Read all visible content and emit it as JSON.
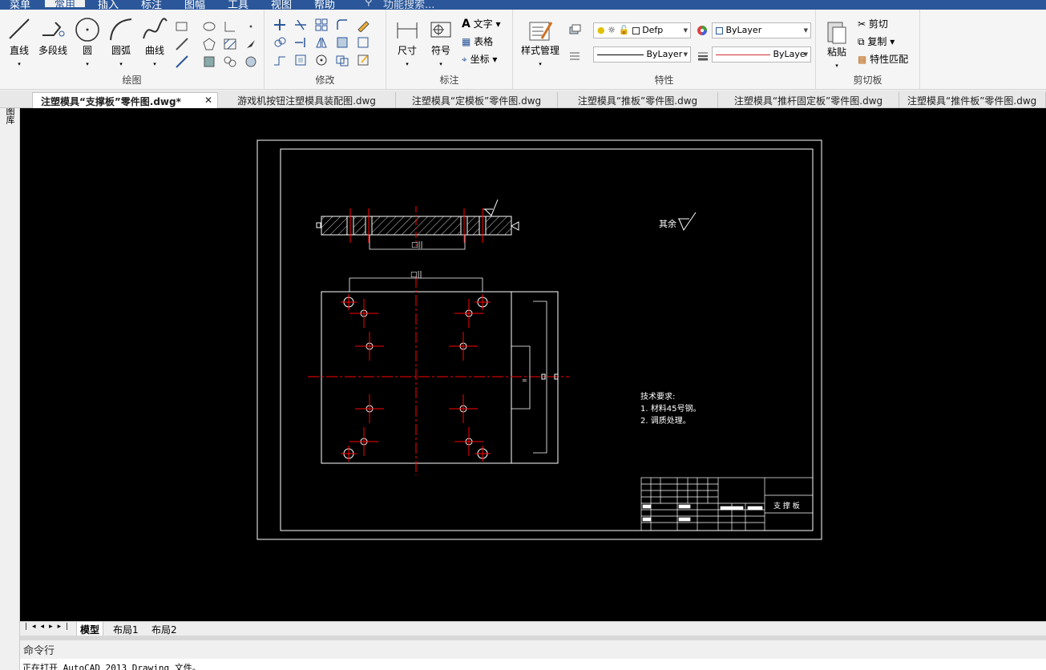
{
  "menu": {
    "items": [
      "菜单",
      "常用",
      "插入",
      "标注",
      "图幅",
      "工具",
      "视图",
      "帮助"
    ],
    "search_placeholder": "功能搜索..."
  },
  "ribbon": {
    "draw": {
      "title": "绘图",
      "line": "直线",
      "polyline": "多段线",
      "circle": "圆",
      "arc": "圆弧",
      "spline": "曲线"
    },
    "modify": {
      "title": "修改"
    },
    "annotate": {
      "title": "标注",
      "dimension": "尺寸",
      "symbol": "符号",
      "text": "文字",
      "table": "表格",
      "coordinate": "坐标"
    },
    "properties": {
      "title": "特性",
      "style_manager": "样式管理",
      "layer_value": "Defp",
      "color_value": "ByLayer",
      "linetype_value": "ByLayer",
      "lineweight_value": "ByLaye"
    },
    "clipboard": {
      "title": "剪切板",
      "paste": "粘贴",
      "cut": "剪切",
      "copy": "复制",
      "match": "特性匹配"
    }
  },
  "doc_tabs": [
    "注塑模具“支撑板”零件图.dwg*",
    "游戏机按钮注塑模具装配图.dwg",
    "注塑模具“定模板”零件图.dwg",
    "注塑模具“推板”零件图.dwg",
    "注塑模具“推杆固定板”零件图.dwg",
    "注塑模具“推件板”零件图.dwg"
  ],
  "sidebar_label": "图库",
  "drawing": {
    "surface_label": "其余",
    "tech_title": "技术要求:",
    "tech_1": "1. 材料45号钢。",
    "tech_2": "2. 调质处理。",
    "part_name": "支 撑 板"
  },
  "layout_tabs": [
    "模型",
    "布局1",
    "布局2"
  ],
  "command": {
    "label": "命令行",
    "log": "正在打开 AutoCAD 2013 Drawing 文件。"
  },
  "colors": {
    "menubar": "#2b579a",
    "canvas": "#000000",
    "centerline": "#ff0000",
    "geometry": "#ffffff"
  }
}
